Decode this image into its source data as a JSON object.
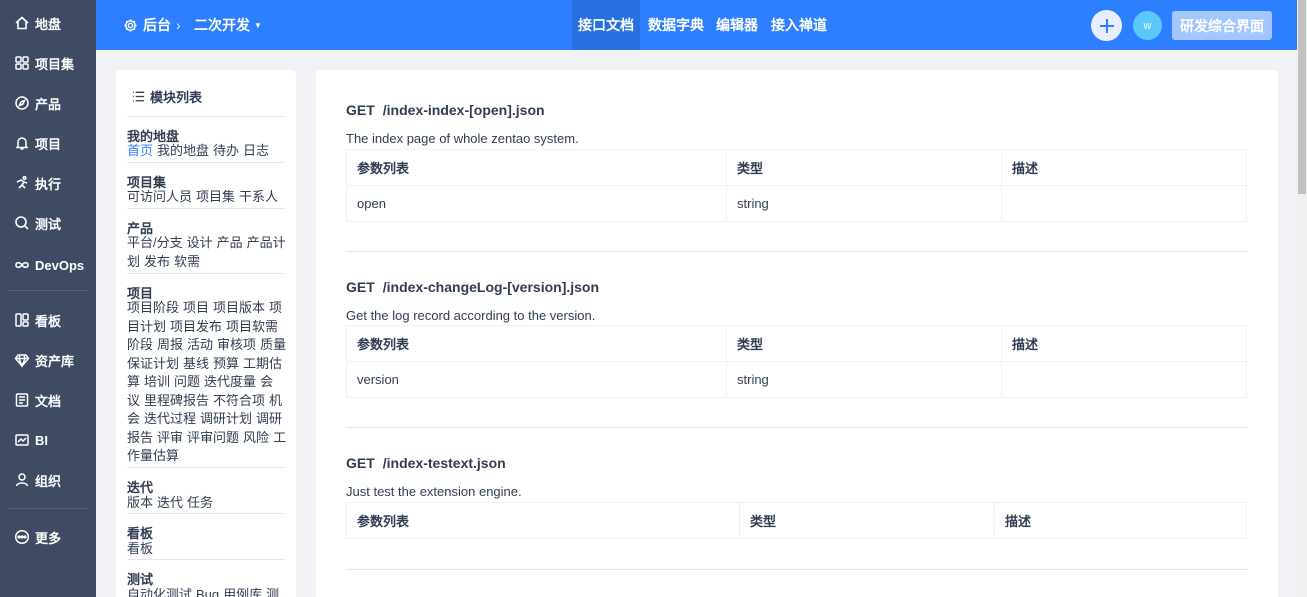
{
  "nav": {
    "items": [
      {
        "label": "地盘",
        "icon": "home-icon"
      },
      {
        "label": "项目集",
        "icon": "grid-icon"
      },
      {
        "label": "产品",
        "icon": "compass-icon"
      },
      {
        "label": "项目",
        "icon": "bell-icon"
      },
      {
        "label": "执行",
        "icon": "run-icon"
      },
      {
        "label": "测试",
        "icon": "search-check-icon"
      },
      {
        "label": "DevOps",
        "icon": "infinity-icon"
      },
      {
        "label": "看板",
        "icon": "kanban-icon"
      },
      {
        "label": "资产库",
        "icon": "diamond-icon"
      },
      {
        "label": "文档",
        "icon": "doc-icon"
      },
      {
        "label": "BI",
        "icon": "chart-icon"
      },
      {
        "label": "组织",
        "icon": "user-icon"
      },
      {
        "label": "更多",
        "icon": "more-icon"
      }
    ]
  },
  "topbar": {
    "home_label": "后台",
    "sub_label": "二次开发",
    "tabs": [
      "接口文档",
      "数据字典",
      "编辑器",
      "接入禅道"
    ],
    "avatar_letter": "w",
    "switch_label": "研发综合界面"
  },
  "modules": {
    "title": "模块列表",
    "groups": [
      {
        "name": "我的地盘",
        "links": [
          "首页",
          "我的地盘",
          "待办",
          "日志"
        ],
        "current": "首页"
      },
      {
        "name": "项目集",
        "links": [
          "可访问人员",
          "项目集",
          "干系人"
        ]
      },
      {
        "name": "产品",
        "links": [
          "平台/分支",
          "设计",
          "产品",
          "产品计划",
          "发布",
          "软需"
        ]
      },
      {
        "name": "项目",
        "links": [
          "项目阶段",
          "项目",
          "项目版本",
          "项目计划",
          "项目发布",
          "项目软需",
          "阶段",
          "周报",
          "活动",
          "审核项",
          "质量保证计划",
          "基线",
          "预算",
          "工期估算",
          "培训",
          "问题",
          "迭代度量",
          "会议",
          "里程碑报告",
          "不符合项",
          "机会",
          "迭代过程",
          "调研计划",
          "调研报告",
          "评审",
          "评审问题",
          "风险",
          "工作量估算"
        ]
      },
      {
        "name": "迭代",
        "links": [
          "版本",
          "迭代",
          "任务"
        ]
      },
      {
        "name": "看板",
        "links": [
          "看板"
        ]
      },
      {
        "name": "测试",
        "links": [
          "自动化测试",
          "Bug",
          "用例库",
          "测"
        ]
      }
    ]
  },
  "apis": [
    {
      "method": "GET",
      "path": "/index-index-[open].json",
      "desc": "The index page of whole zentao system.",
      "headers": [
        "参数列表",
        "类型",
        "描述"
      ],
      "rows": [
        {
          "name": "open",
          "type": "string",
          "desc": ""
        }
      ]
    },
    {
      "method": "GET",
      "path": "/index-changeLog-[version].json",
      "desc": "Get the log record according to the version.",
      "headers": [
        "参数列表",
        "类型",
        "描述"
      ],
      "rows": [
        {
          "name": "version",
          "type": "string",
          "desc": ""
        }
      ]
    },
    {
      "method": "GET",
      "path": "/index-testext.json",
      "desc": "Just test the extension engine.",
      "headers": [
        "参数列表",
        "类型",
        "描述"
      ],
      "rows": []
    }
  ],
  "colors": {
    "primary": "#2e7fff",
    "sidebar": "#3f4b63",
    "background": "#f0f2f5"
  }
}
